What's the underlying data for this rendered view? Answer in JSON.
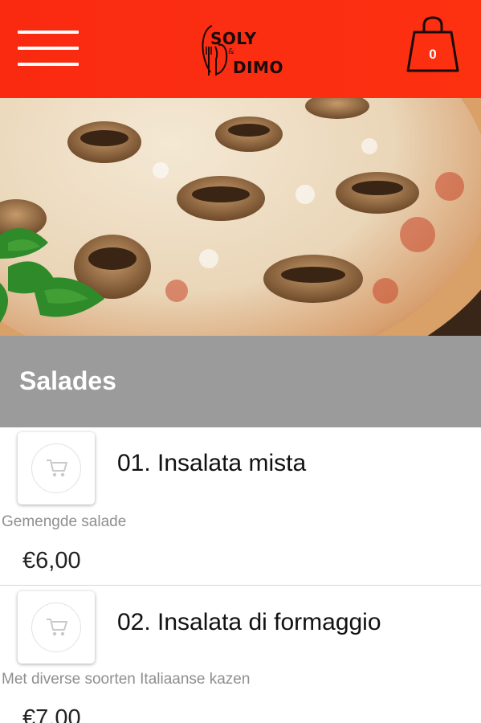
{
  "header": {
    "logo_line1": "SOLY",
    "logo_amp": "&",
    "logo_line2": "DIMO",
    "cart_count": "0"
  },
  "colors": {
    "header_bg": "#fb2e12",
    "section_bg": "#9b9b9b"
  },
  "icons": {
    "menu": "hamburger-menu-icon",
    "cart": "shopping-bag-icon",
    "add": "add-to-cart-icon"
  },
  "section": {
    "title": "Salades"
  },
  "items": [
    {
      "name": "01. Insalata mista",
      "description": "Gemengde salade",
      "price": "€6,00"
    },
    {
      "name": "02. Insalata di formaggio",
      "description": "Met diverse soorten Italiaanse kazen",
      "price": "€7,00"
    }
  ]
}
